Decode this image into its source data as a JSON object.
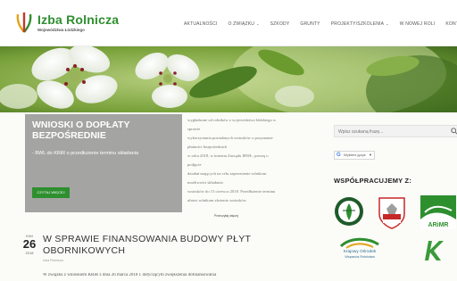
{
  "header": {
    "logo_title": "Izba Rolnicza",
    "logo_sub": "Województwa Łódzkiego",
    "nav": [
      {
        "label": "AKTUALNOŚCI",
        "dropdown": false
      },
      {
        "label": "O ZWIĄZKU",
        "dropdown": true
      },
      {
        "label": "SZKODY",
        "dropdown": false
      },
      {
        "label": "GRUNTY",
        "dropdown": false
      },
      {
        "label": "PROJEKTY/SZKOLENIA",
        "dropdown": true
      },
      {
        "label": "W NOWEJ ROLI",
        "dropdown": false
      },
      {
        "label": "KONTAKT",
        "dropdown": false
      }
    ]
  },
  "slider": {
    "title": "WNIOSKI O DOPŁATY BEZPOŚREDNIE",
    "text": "- BWL do KRiR o przedłużenie terminu składania",
    "button": "CZYTAJ WIĘCEJ",
    "bg_lines": [
      "wygładzone od rolników z województwa łódzkiego w sprawie",
      "wykorzystania posiadanych wniosków o przyznanie płatności bezpośrednich",
      "w roku 2018, w imieniu Zarządu IRWŁ, proszę o podjęcie",
      "działań mających na celu zapewnienie rolnikom możliwości składania",
      "wniosków do 15 czerwca 2018. Przedłużenie terminu ułatwi rolnikom złożenie wniosków"
    ],
    "bg_link": "Przeczytaj więcej"
  },
  "sidebar": {
    "search_placeholder": "Wpisz szukaną frazę...",
    "lang_label": "Wybierz język",
    "partners_title": "WSPÓŁPRACUJEMY Z:",
    "partners": [
      {
        "name": "ARiMR",
        "caption": ""
      },
      {
        "name": "Krajowy Ośrodek Wsparcia Rolnictwa",
        "line1": "Krajowy Ośrodek",
        "line2": "Wsparcia Rolnictwa"
      }
    ]
  },
  "article": {
    "month": "KWI",
    "day": "26",
    "year": "2018",
    "title": "W SPRAWIE FINANSOWANIA BUDOWY PŁYT OBORNIKOWYCH",
    "author": "Izba Rolnicza",
    "excerpt": "W związku z wnioskiem KRiR z dnia 26 marca 2018 r. dotyczącym zwiększenia dofinansowania"
  },
  "colors": {
    "brand_green": "#2e8f2f",
    "overlay_gray": "#8c8c8c"
  }
}
